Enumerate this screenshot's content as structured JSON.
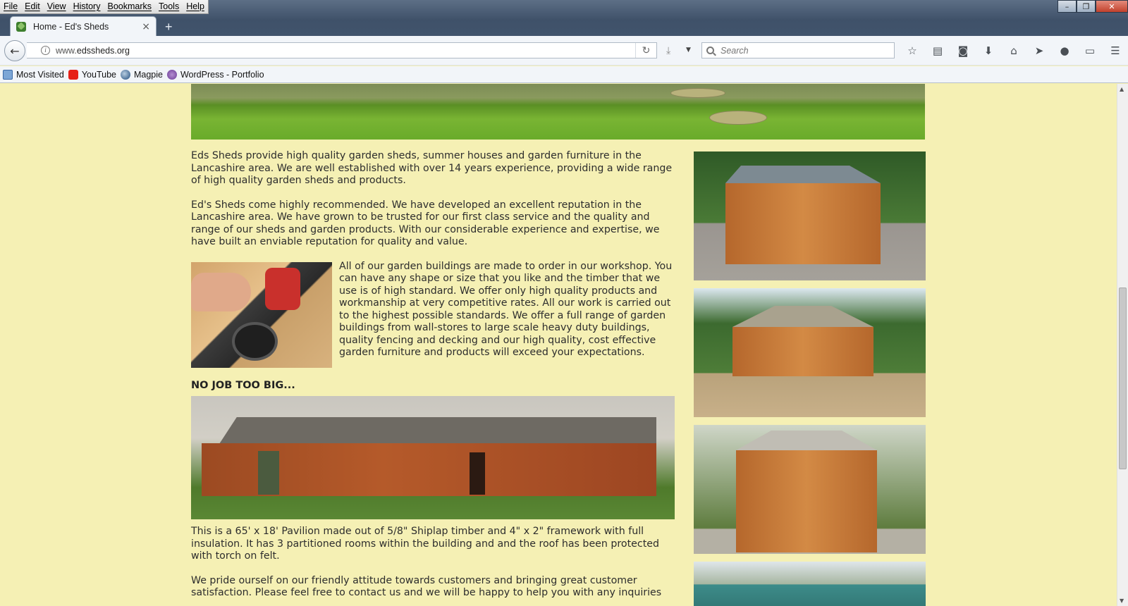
{
  "menubar": [
    "File",
    "Edit",
    "View",
    "History",
    "Bookmarks",
    "Tools",
    "Help"
  ],
  "window_controls": {
    "minimize": "–",
    "maximize": "❐",
    "close": "✕"
  },
  "tab": {
    "title": "Home - Ed's Sheds",
    "close": "×",
    "new_tab": "+"
  },
  "navbar": {
    "url_prefix": "www.",
    "url_domain": "edssheds.org",
    "search_placeholder": "Search"
  },
  "toolbar_icons": [
    "star-icon",
    "reading-list-icon",
    "pocket-icon",
    "downloads-icon",
    "home-icon",
    "send-icon",
    "chat-icon",
    "window-icon",
    "menu-icon"
  ],
  "bookmarks": [
    {
      "label": "Most Visited",
      "icon": "most-visited-icon"
    },
    {
      "label": "YouTube",
      "icon": "youtube-icon"
    },
    {
      "label": "Magpie",
      "icon": "magpie-icon"
    },
    {
      "label": "WordPress - Portfolio",
      "icon": "wordpress-icon"
    }
  ],
  "page": {
    "para1": "Eds Sheds provide high quality garden sheds, summer houses and garden furniture in the Lancashire area. We are well established with over 14 years experience, providing a wide range of high quality garden sheds and products.",
    "para2": "Ed's Sheds come highly recommended. We have developed an excellent reputation in the Lancashire area. We have grown to be trusted for our first class service and the quality and range of our sheds and garden products. With our considerable experience and expertise, we have built an enviable reputation for quality and value.",
    "para3": "All of our garden buildings are made to order in our workshop. You can have any shape or size that you like and the timber that we use is of high standard. We offer only high quality products and workmanship at very competitive rates. All our work is carried out to the highest possible standards. We offer a full range of garden buildings from wall-stores to large scale heavy duty buildings, quality fencing and decking and our high quality, cost effective garden furniture and products will exceed your expectations.",
    "heading": "NO JOB TOO BIG...",
    "para4": "This is a 65' x 18' Pavilion made out of 5/8\" Shiplap timber and 4\" x 2\" framework with full insulation. It has 3 partitioned rooms within the building and and the roof has been protected with torch on felt.",
    "para5": "We pride ourself on our friendly attitude towards customers and bringing great customer satisfaction. Please feel free to contact us and we will be happy to help you with any inquiries"
  }
}
